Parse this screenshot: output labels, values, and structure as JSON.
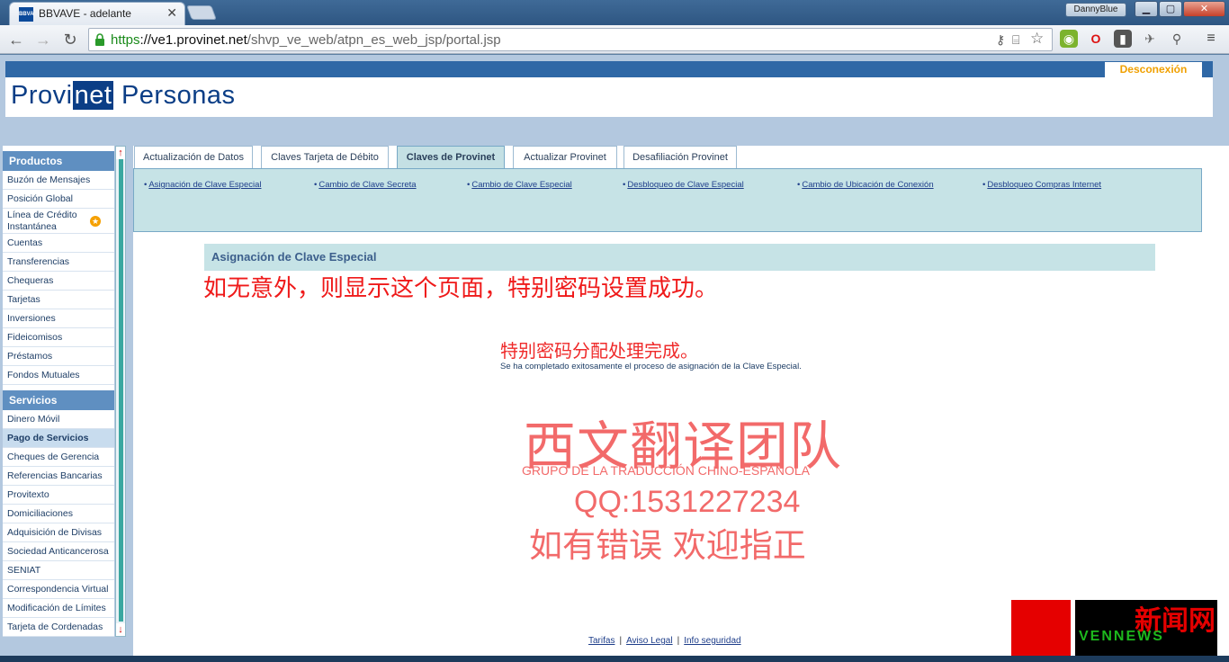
{
  "browser": {
    "tab_title": "BBVAVE - adelante",
    "favicon_text": "BBVA",
    "tab_close": "✕",
    "user": "DannyBlue",
    "url_https": "https",
    "url_host": "://ve1.provinet.net",
    "url_path": "/shvp_ve_web/atpn_es_web_jsp/portal.jsp"
  },
  "header": {
    "logo_pre": "Provi",
    "logo_net": "net",
    "logo_post": " Personas",
    "logout": "Desconexión"
  },
  "sidebar": {
    "products_title": "Productos",
    "products": [
      "Buzón de Mensajes",
      "Posición Global",
      "Línea de Crédito Instantánea",
      "Cuentas",
      "Transferencias",
      "Chequeras",
      "Tarjetas",
      "Inversiones",
      "Fideicomisos",
      "Préstamos",
      "Fondos Mutuales"
    ],
    "services_title": "Servicios",
    "services": [
      "Dinero Móvil",
      "Pago de Servicios",
      "Cheques de Gerencia",
      "Referencias Bancarias",
      "Provitexto",
      "Domiciliaciones",
      "Adquisición de Divisas",
      "Sociedad Anticancerosa",
      "SENIAT",
      "Correspondencia Virtual",
      "Modificación de Límites",
      "Tarjeta de Cordenadas"
    ]
  },
  "tabs": [
    "Actualización de Datos",
    "Claves Tarjeta de Débito",
    "Claves de Provinet",
    "Actualizar Provinet",
    "Desafiliación Provinet"
  ],
  "sublinks": [
    "Asignación de Clave Especial",
    "Cambio de Clave Secreta",
    "Cambio de Clave Especial",
    "Desbloqueo de Clave Especial",
    "Cambio de Ubicación de Conexión",
    "Desbloqueo Compras Internet"
  ],
  "content": {
    "section_title": "Asignación de Clave Especial",
    "annotation_1": "如无意外，则显示这个页面，特别密码设置成功。",
    "annotation_2": "特别密码分配处理完成。",
    "success_message": "Se ha completado exitosamente el proceso de asignación de la Clave Especial.",
    "watermark_cn": "西文翻译团队",
    "watermark_es": "GRUPO DE LA TRADUCCIÓN CHINO-ESPAÑOLA",
    "watermark_qq": "QQ:1531227234",
    "watermark_cn2": "如有错误 欢迎指正"
  },
  "footer": {
    "tarifas": "Tarifas",
    "aviso": "Aviso Legal",
    "info": "Info seguridad",
    "separator": "|"
  },
  "news_badge": {
    "cn": "新闻网",
    "en": "VENNEWS"
  },
  "colors": {
    "brand_blue": "#0b3e86",
    "panel_teal": "#c6e3e6",
    "annotation_red": "#ef1a1a"
  }
}
